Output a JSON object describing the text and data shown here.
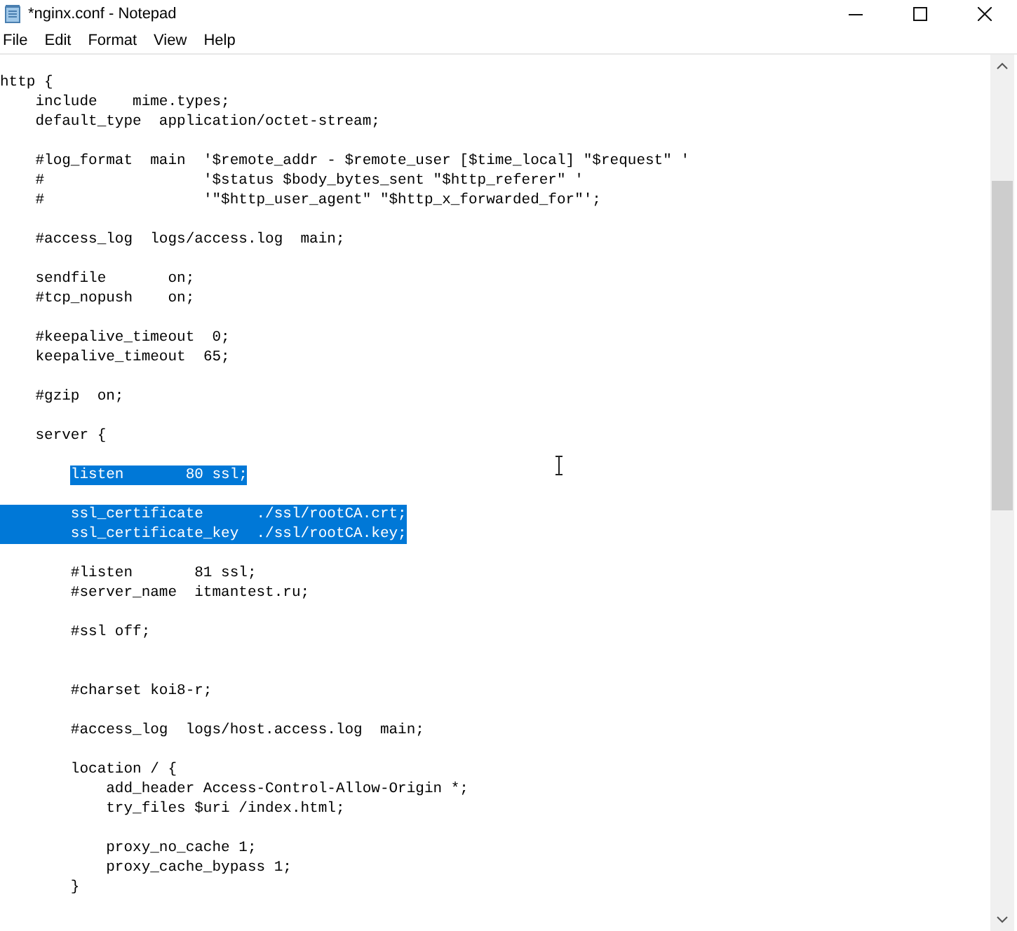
{
  "window": {
    "title": "*nginx.conf - Notepad"
  },
  "menu": [
    {
      "label": "File"
    },
    {
      "label": "Edit"
    },
    {
      "label": "Format"
    },
    {
      "label": "View"
    },
    {
      "label": "Help"
    }
  ],
  "lines": [
    {
      "kind": "code",
      "text": "http {",
      "selected": false,
      "margin_selected": false
    },
    {
      "kind": "code",
      "text": "    include    mime.types;",
      "selected": false,
      "margin_selected": false
    },
    {
      "kind": "code",
      "text": "    default_type  application/octet-stream;",
      "selected": false,
      "margin_selected": false
    },
    {
      "kind": "blank"
    },
    {
      "kind": "code",
      "text": "    #log_format  main  '$remote_addr - $remote_user [$time_local] \"$request\" '",
      "selected": false,
      "margin_selected": false
    },
    {
      "kind": "code",
      "text": "    #                  '$status $body_bytes_sent \"$http_referer\" '",
      "selected": false,
      "margin_selected": false
    },
    {
      "kind": "code",
      "text": "    #                  '\"$http_user_agent\" \"$http_x_forwarded_for\"';",
      "selected": false,
      "margin_selected": false
    },
    {
      "kind": "blank"
    },
    {
      "kind": "code",
      "text": "    #access_log  logs/access.log  main;",
      "selected": false,
      "margin_selected": false
    },
    {
      "kind": "blank"
    },
    {
      "kind": "code",
      "text": "    sendfile       on;",
      "selected": false,
      "margin_selected": false
    },
    {
      "kind": "code",
      "text": "    #tcp_nopush    on;",
      "selected": false,
      "margin_selected": false
    },
    {
      "kind": "blank"
    },
    {
      "kind": "code",
      "text": "    #keepalive_timeout  0;",
      "selected": false,
      "margin_selected": false
    },
    {
      "kind": "code",
      "text": "    keepalive_timeout  65;",
      "selected": false,
      "margin_selected": false
    },
    {
      "kind": "blank"
    },
    {
      "kind": "code",
      "text": "    #gzip  on;",
      "selected": false,
      "margin_selected": false
    },
    {
      "kind": "blank"
    },
    {
      "kind": "code",
      "text": "    server {",
      "selected": false,
      "margin_selected": false
    },
    {
      "kind": "blank"
    },
    {
      "kind": "code",
      "text": "        listen       80 ssl;",
      "selected": true,
      "margin_selected": false
    },
    {
      "kind": "blank"
    },
    {
      "kind": "code",
      "text": "        ssl_certificate      ./ssl/rootCA.crt;",
      "selected": true,
      "margin_selected": true
    },
    {
      "kind": "code",
      "text": "        ssl_certificate_key  ./ssl/rootCA.key;",
      "selected": true,
      "margin_selected": true
    },
    {
      "kind": "blank"
    },
    {
      "kind": "code",
      "text": "        #listen       81 ssl;",
      "selected": false,
      "margin_selected": false
    },
    {
      "kind": "code",
      "text": "        #server_name  itmantest.ru;",
      "selected": false,
      "margin_selected": false
    },
    {
      "kind": "blank"
    },
    {
      "kind": "code",
      "text": "        #ssl off;",
      "selected": false,
      "margin_selected": false
    },
    {
      "kind": "blank"
    },
    {
      "kind": "blank"
    },
    {
      "kind": "code",
      "text": "        #charset koi8-r;",
      "selected": false,
      "margin_selected": false
    },
    {
      "kind": "blank"
    },
    {
      "kind": "code",
      "text": "        #access_log  logs/host.access.log  main;",
      "selected": false,
      "margin_selected": false
    },
    {
      "kind": "blank"
    },
    {
      "kind": "code",
      "text": "        location / {",
      "selected": false,
      "margin_selected": false
    },
    {
      "kind": "code",
      "text": "            add_header Access-Control-Allow-Origin *;",
      "selected": false,
      "margin_selected": false
    },
    {
      "kind": "code",
      "text": "            try_files $uri /index.html;",
      "selected": false,
      "margin_selected": false
    },
    {
      "kind": "blank"
    },
    {
      "kind": "code",
      "text": "            proxy_no_cache 1;",
      "selected": false,
      "margin_selected": false
    },
    {
      "kind": "code",
      "text": "            proxy_cache_bypass 1;",
      "selected": false,
      "margin_selected": false
    },
    {
      "kind": "code",
      "text": "        }",
      "selected": false,
      "margin_selected": false
    }
  ]
}
